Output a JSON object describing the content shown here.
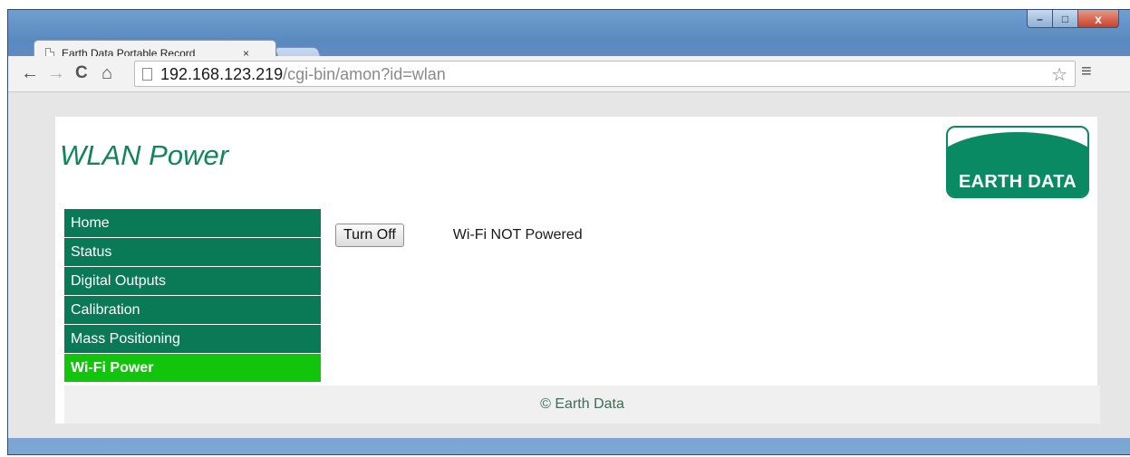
{
  "browser": {
    "tab_title": "Earth Data Portable Record",
    "tab_close": "×",
    "url_host": "192.168.123.219",
    "url_path": "/cgi-bin/amon?id=wlan",
    "window_controls": {
      "minimize": "–",
      "maximize": "□",
      "close": "x"
    },
    "icons": {
      "back": "←",
      "forward": "→",
      "reload": "C",
      "home": "⌂",
      "bookmark": "☆",
      "menu": "≡"
    }
  },
  "page": {
    "title": "WLAN Power",
    "logo_text": "EARTH DATA",
    "brand_colors": {
      "primary": "#0a7a56",
      "active": "#13c40c"
    }
  },
  "sidebar": {
    "items": [
      {
        "label": "Home",
        "active": false
      },
      {
        "label": "Status",
        "active": false
      },
      {
        "label": "Digital Outputs",
        "active": false
      },
      {
        "label": "Calibration",
        "active": false
      },
      {
        "label": "Mass Positioning",
        "active": false
      },
      {
        "label": "Wi-Fi Power",
        "active": true
      }
    ]
  },
  "content": {
    "button_label": "Turn Off",
    "status_text": "Wi-Fi NOT Powered"
  },
  "footer": {
    "text": "© Earth Data"
  }
}
